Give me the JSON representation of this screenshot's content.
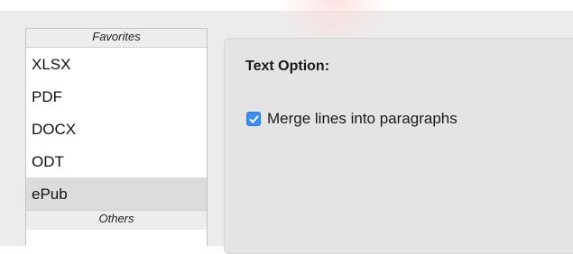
{
  "sidebar": {
    "favorites_header": "Favorites",
    "items": [
      {
        "label": "XLSX",
        "selected": false
      },
      {
        "label": "PDF",
        "selected": false
      },
      {
        "label": "DOCX",
        "selected": false
      },
      {
        "label": "ODT",
        "selected": false
      },
      {
        "label": "ePub",
        "selected": true
      }
    ],
    "others_header": "Others"
  },
  "panel": {
    "title": "Text Option:",
    "options": [
      {
        "label": "Merge lines into paragraphs",
        "checked": true,
        "icon": "checkmark-icon"
      }
    ]
  },
  "colors": {
    "accent": "#3a8ef3",
    "selected_row": "#dcdcdc",
    "window_bg": "#ececec"
  }
}
